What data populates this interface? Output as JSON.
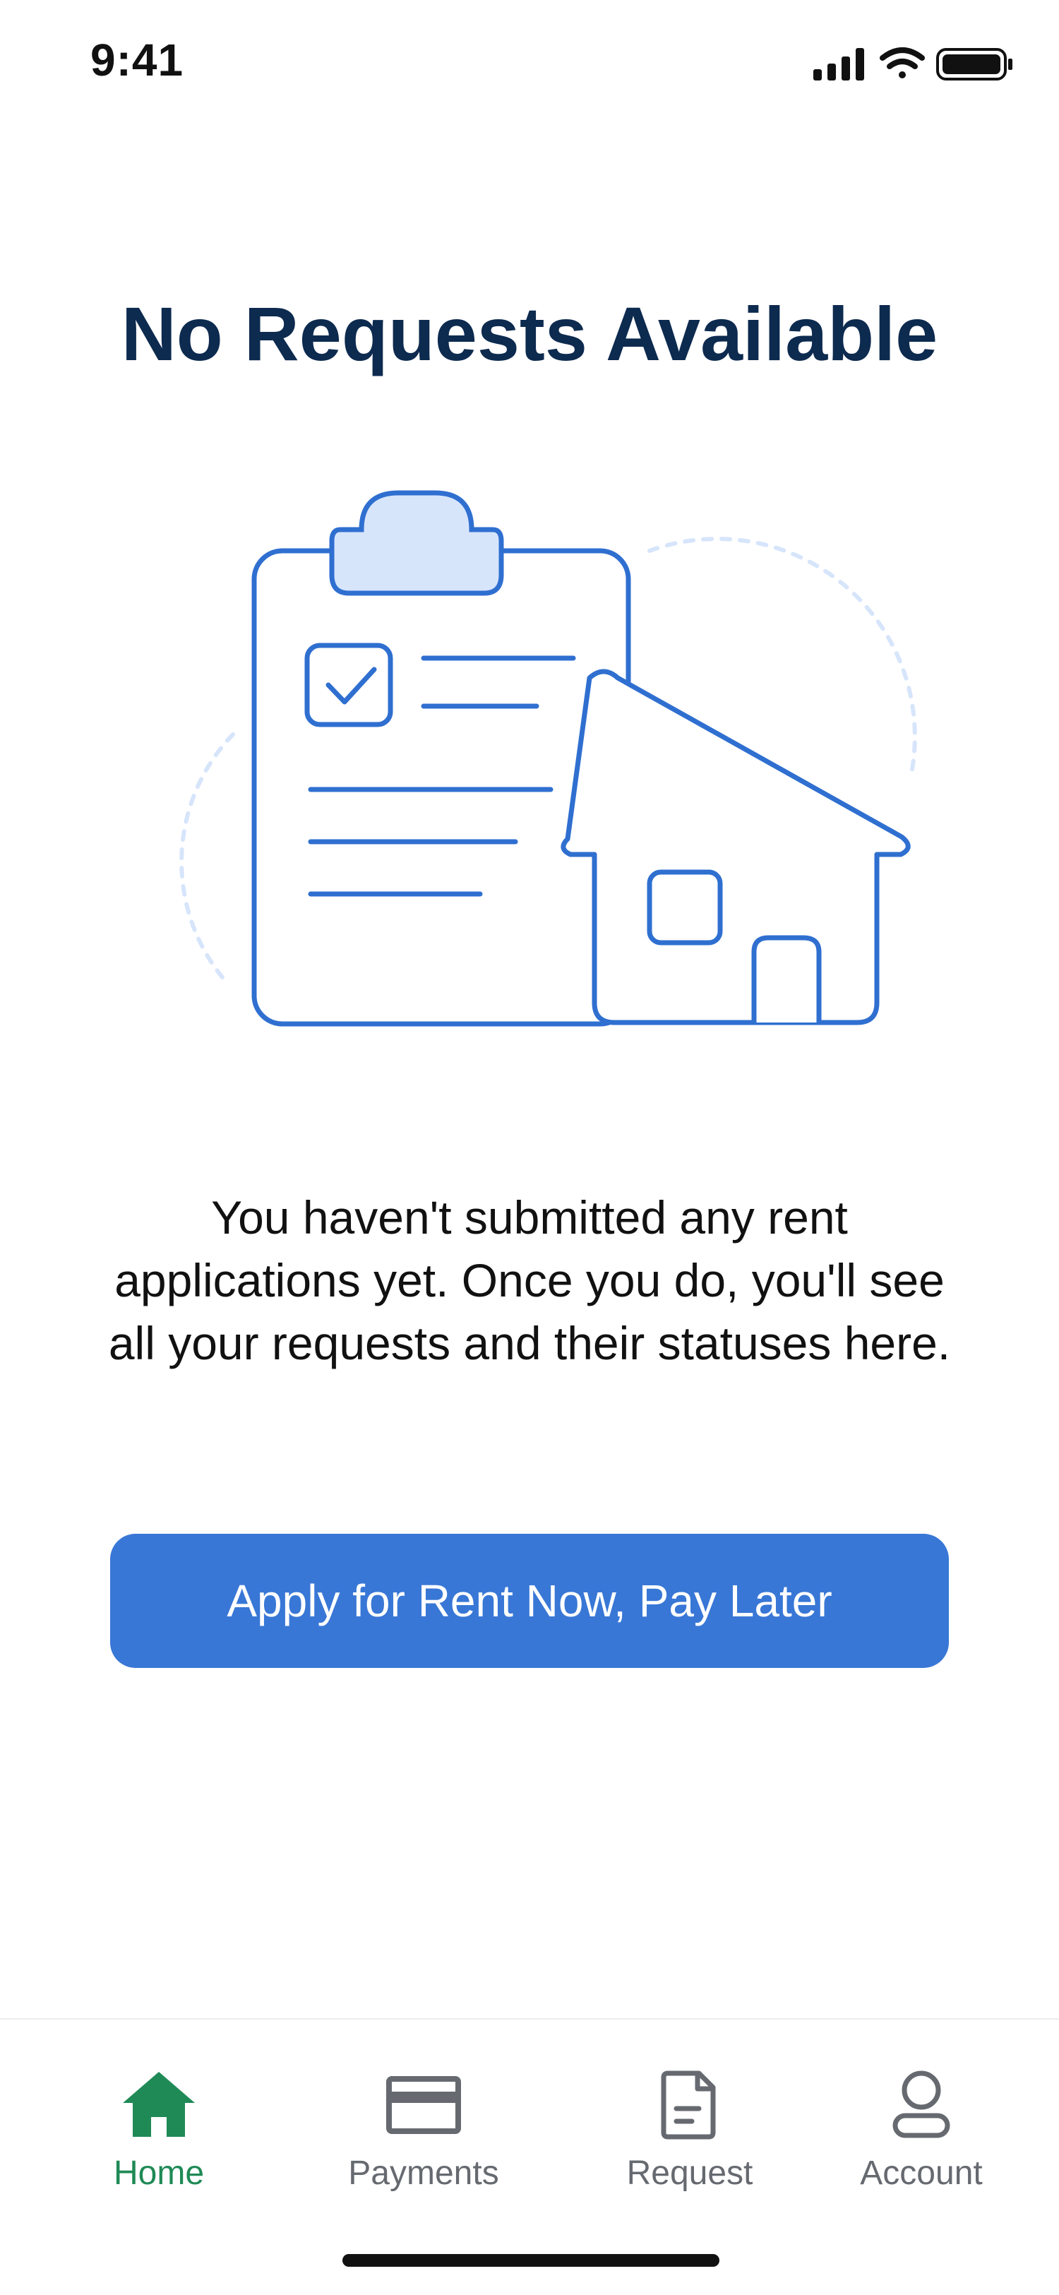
{
  "status_bar": {
    "time": "9:41",
    "icons": [
      "signal-icon",
      "wifi-icon",
      "battery-icon"
    ]
  },
  "empty_state": {
    "title": "No Requests Available",
    "illustration": "clipboard-house-illustration",
    "description": "You haven't submitted any rent applications yet. Once you do, you'll see all your requests and their statuses here.",
    "cta_label": "Apply for Rent Now, Pay Later"
  },
  "tab_bar": {
    "active": "home",
    "items": [
      {
        "key": "home",
        "label": "Home",
        "icon": "home-icon"
      },
      {
        "key": "payments",
        "label": "Payments",
        "icon": "card-icon"
      },
      {
        "key": "request",
        "label": "Request",
        "icon": "document-icon"
      },
      {
        "key": "account",
        "label": "Account",
        "icon": "user-icon"
      }
    ]
  },
  "colors": {
    "title": "#0d2a4f",
    "accent_blue": "#3877d6",
    "illustration_stroke": "#2f6fd0",
    "illustration_fill": "#d7e5fb",
    "active_tab": "#1f8a56",
    "inactive_tab": "#666a70"
  }
}
